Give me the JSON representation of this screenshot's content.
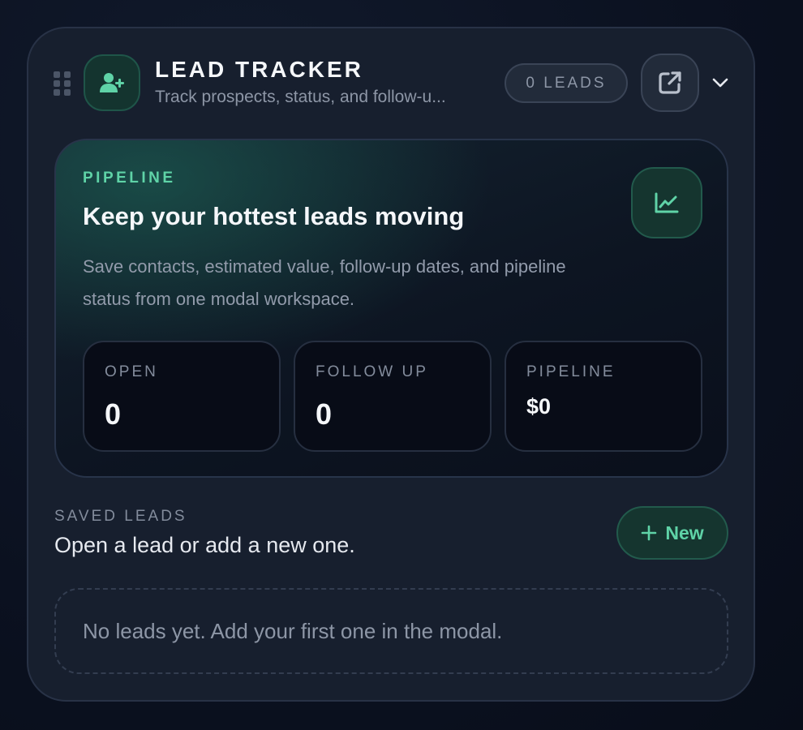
{
  "header": {
    "title": "LEAD TRACKER",
    "subtitle": "Track prospects, status, and follow-u...",
    "lead_count_badge": "0 LEADS"
  },
  "icons": {
    "app": "user-plus-icon",
    "open_external": "external-link-icon",
    "collapse": "chevron-down-icon",
    "chart": "trend-chart-icon",
    "drag": "drag-handle-icon",
    "plus": "plus-icon"
  },
  "hero": {
    "eyebrow": "PIPELINE",
    "heading": "Keep your hottest leads moving",
    "body": "Save contacts, estimated value, follow-up dates, and pipeline status from one modal workspace.",
    "stats": [
      {
        "label": "OPEN",
        "value": "0"
      },
      {
        "label": "FOLLOW UP",
        "value": "0"
      },
      {
        "label": "PIPELINE",
        "value": "$0"
      }
    ]
  },
  "saved_leads": {
    "label": "SAVED LEADS",
    "description": "Open a lead or add a new one.",
    "new_button": "New",
    "empty_message": "No leads yet. Add your first one in the modal."
  },
  "colors": {
    "accent": "#5fd3a7",
    "background": "#0b1120",
    "card": "#171f2e"
  }
}
